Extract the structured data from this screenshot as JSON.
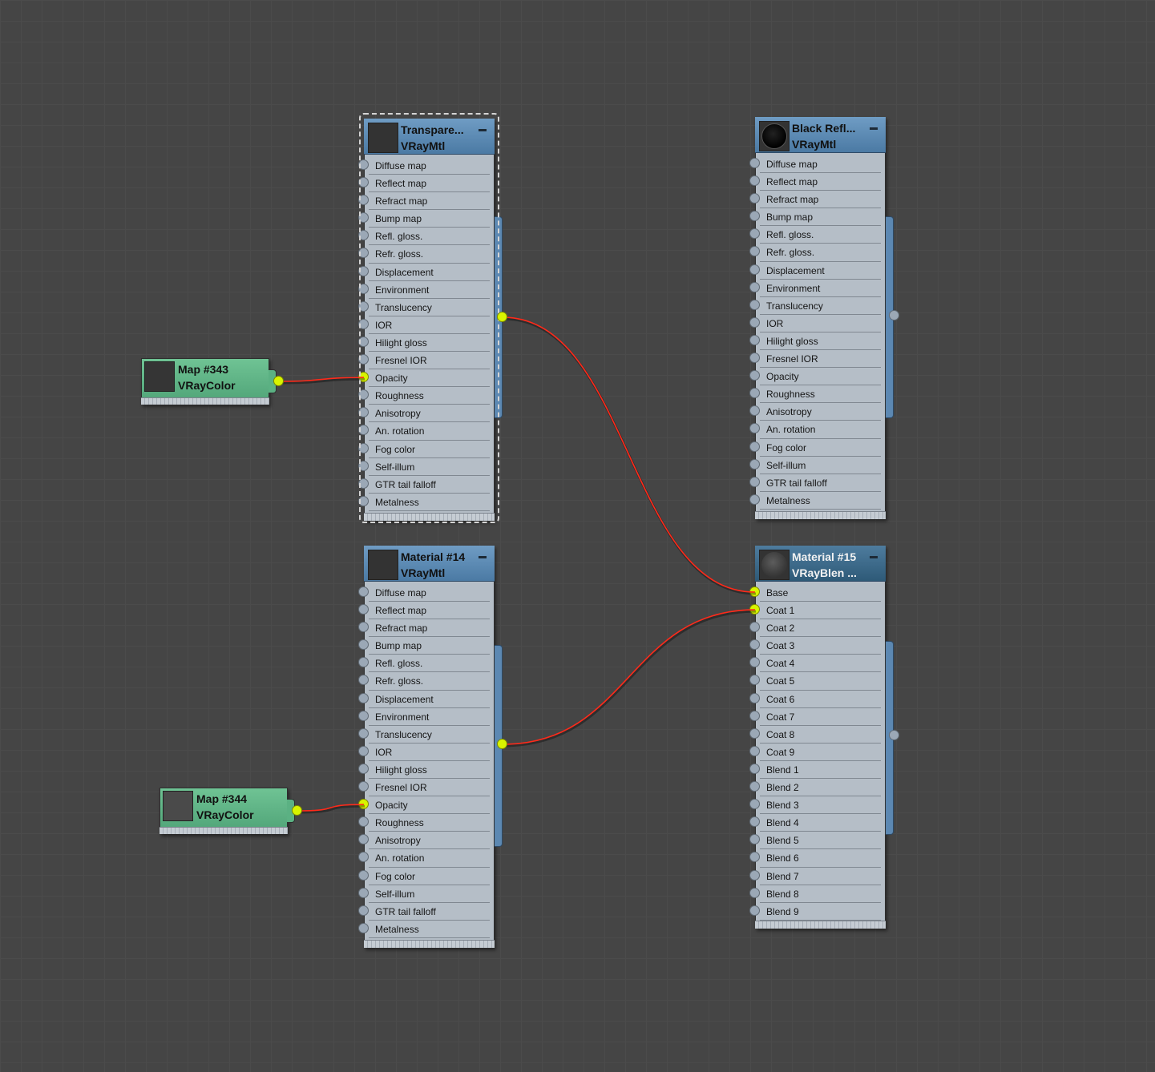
{
  "colors": {
    "canvas": "#454545",
    "node_body": "#b5bec7",
    "material_header": "#5f8db7",
    "blend_header": "#3d6a8c",
    "map_node": "#5fb386",
    "wire": "#ff2a1a",
    "port_connected": "#d8f400",
    "port_idle": "#9ba8b6"
  },
  "nodes": [
    {
      "id": "transparent",
      "title": "Transpare...",
      "subtitle": "VRayMtl",
      "thumbnail": "dark-gray-swatch",
      "selected": true,
      "slots": [
        "Diffuse map",
        "Reflect map",
        "Refract map",
        "Bump map",
        "Refl. gloss.",
        "Refr. gloss.",
        "Displacement",
        "Environment",
        "Translucency",
        "IOR",
        "Hilight gloss",
        "Fresnel IOR",
        "Opacity",
        "Roughness",
        "Anisotropy",
        "An. rotation",
        "Fog color",
        "Self-illum",
        "GTR tail falloff",
        "Metalness"
      ],
      "connected_slots": [
        "Opacity"
      ],
      "output_connected": true
    },
    {
      "id": "black-refl",
      "title": "Black Refl...",
      "subtitle": "VRayMtl",
      "thumbnail": "black-sphere",
      "selected": false,
      "slots": [
        "Diffuse map",
        "Reflect map",
        "Refract map",
        "Bump map",
        "Refl. gloss.",
        "Refr. gloss.",
        "Displacement",
        "Environment",
        "Translucency",
        "IOR",
        "Hilight gloss",
        "Fresnel IOR",
        "Opacity",
        "Roughness",
        "Anisotropy",
        "An. rotation",
        "Fog color",
        "Self-illum",
        "GTR tail falloff",
        "Metalness"
      ],
      "connected_slots": [],
      "output_connected": false
    },
    {
      "id": "material14",
      "title": "Material #14",
      "subtitle": "VRayMtl",
      "thumbnail": "dark-gray-swatch",
      "selected": false,
      "slots": [
        "Diffuse map",
        "Reflect map",
        "Refract map",
        "Bump map",
        "Refl. gloss.",
        "Refr. gloss.",
        "Displacement",
        "Environment",
        "Translucency",
        "IOR",
        "Hilight gloss",
        "Fresnel IOR",
        "Opacity",
        "Roughness",
        "Anisotropy",
        "An. rotation",
        "Fog color",
        "Self-illum",
        "GTR tail falloff",
        "Metalness"
      ],
      "connected_slots": [
        "Opacity"
      ],
      "output_connected": true
    },
    {
      "id": "material15",
      "title": "Material #15",
      "subtitle": "VRayBlen ...",
      "thumbnail": "fabric-sphere",
      "selected": false,
      "slots": [
        "Base",
        "Coat 1",
        "Coat 2",
        "Coat 3",
        "Coat 4",
        "Coat 5",
        "Coat 6",
        "Coat 7",
        "Coat 8",
        "Coat 9",
        "Blend 1",
        "Blend 2",
        "Blend 3",
        "Blend 4",
        "Blend 5",
        "Blend 6",
        "Blend 7",
        "Blend 8",
        "Blend 9"
      ],
      "connected_slots": [
        "Base",
        "Coat 1"
      ],
      "output_connected": false
    }
  ],
  "maps": [
    {
      "id": "map343",
      "title": "Map #343",
      "subtitle": "VRayColor",
      "swatch": "#353535"
    },
    {
      "id": "map344",
      "title": "Map #344",
      "subtitle": "VRayColor",
      "swatch": "#4a4a4a"
    }
  ],
  "connections": [
    {
      "from": "map343",
      "to": "transparent",
      "slot": "Opacity"
    },
    {
      "from": "map344",
      "to": "material14",
      "slot": "Opacity"
    },
    {
      "from": "transparent",
      "to": "material15",
      "slot": "Base"
    },
    {
      "from": "material14",
      "to": "material15",
      "slot": "Coat 1"
    }
  ]
}
